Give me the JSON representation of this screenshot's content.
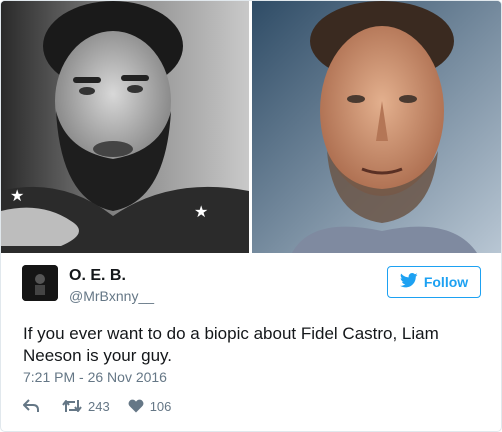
{
  "author": {
    "name": "O. E. B.",
    "handle": "@MrBxnny__"
  },
  "follow": {
    "label": "Follow",
    "icon": "twitter-bird-icon",
    "color": "#1da1f2"
  },
  "tweet": {
    "text": "If you ever want to do a biopic about Fidel Castro, Liam Neeson is your guy.",
    "timestamp": "7:21 PM - 26 Nov 2016"
  },
  "actions": {
    "reply_icon": "reply-icon",
    "retweet_icon": "retweet-icon",
    "retweet_count": "243",
    "like_icon": "heart-icon",
    "like_count": "106"
  },
  "colors": {
    "text": "#14171a",
    "secondary": "#657786",
    "border": "#e1e8ed"
  }
}
